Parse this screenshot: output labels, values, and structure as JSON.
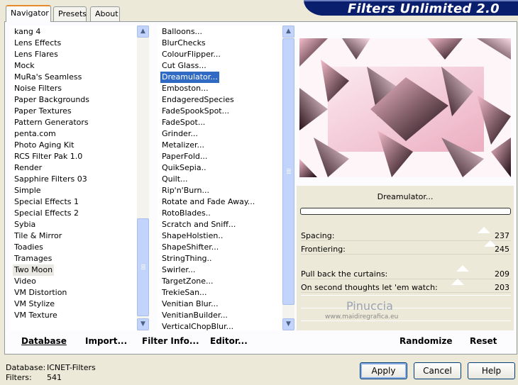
{
  "tabs": [
    {
      "label": "Navigator",
      "active": true
    },
    {
      "label": "Presets",
      "active": false
    },
    {
      "label": "About",
      "active": false
    }
  ],
  "banner": {
    "title": "Filters Unlimited 2.0"
  },
  "categories": [
    "kang 4",
    "Lens Effects",
    "Lens Flares",
    "Mock",
    "MuRa's Seamless",
    "Noise Filters",
    "Paper Backgrounds",
    "Paper Textures",
    "Pattern Generators",
    "penta.com",
    "Photo Aging Kit",
    "RCS Filter Pak 1.0",
    "Render",
    "Sapphire Filters 03",
    "Simple",
    "Special Effects 1",
    "Special Effects 2",
    "Sybia",
    "Tile & Mirror",
    "Toadies",
    "Tramages",
    "Two Moon",
    "Video",
    "VM Distortion",
    "VM Stylize",
    "VM Texture"
  ],
  "selected_category": "Two Moon",
  "filters": [
    "Balloons...",
    "BlurChecks",
    "ColourFlipper...",
    "Cut Glass...",
    "Dreamulator...",
    "Emboston...",
    "EndageredSpecies",
    "FadeSpookSpot...",
    "FadeSpot...",
    "Grinder...",
    "Metalizer...",
    "PaperFold...",
    "QuikSepia..",
    "Quilt...",
    "Rip'n'Burn...",
    "Rotate and Fade Away...",
    "RotoBlades..",
    "Scratch and Sniff...",
    "ShapeHolstien..",
    "ShapeShifter...",
    "StringThing..",
    "Swirler...",
    "TargetZone...",
    "TrekieSan...",
    "Venitian Blur...",
    "VenitianBuilder...",
    "VerticalChopBlur..."
  ],
  "selected_filter": "Dreamulator...",
  "preview": {
    "filter_name": "Dreamulator...",
    "watermark_name": "Pinuccia",
    "watermark_url": "www.maidiregrafica.eu"
  },
  "params": [
    {
      "label": "Spacing:",
      "value": "237",
      "level": 237
    },
    {
      "label": "Frontiering:",
      "value": "245",
      "level": 245
    },
    {
      "label": "Pull back the curtains:",
      "value": "209",
      "level": 209
    },
    {
      "label": "On second thoughts let 'em watch:",
      "value": "203",
      "level": 203
    }
  ],
  "actions": {
    "database": "Database",
    "import": "Import...",
    "filter_info": "Filter Info...",
    "editor": "Editor...",
    "randomize": "Randomize",
    "reset": "Reset"
  },
  "footer": {
    "database_label": "Database:",
    "database_value": "ICNET-Filters",
    "filters_label": "Filters:",
    "filters_value": "541"
  },
  "buttons": {
    "apply": "Apply",
    "cancel": "Cancel",
    "help": "Help"
  },
  "colors": {
    "banner": "#0a1e6e",
    "selection": "#316ac5",
    "scrollbar": "#c3d4fc",
    "preview_pink": "#f4bccb"
  }
}
